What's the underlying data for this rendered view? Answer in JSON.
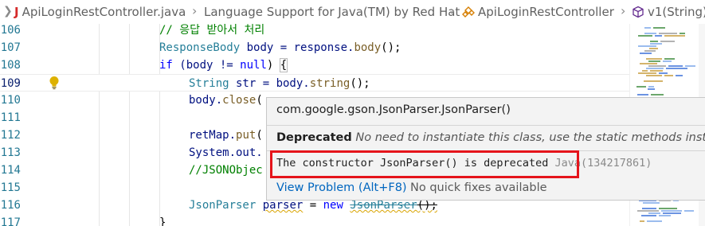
{
  "breadcrumb": {
    "chevron": "❯",
    "file_icon": "J",
    "file_name": "ApiLoginRestController.java",
    "extension": "Language Support for Java(TM) by Red Hat",
    "class_name": "ApiLoginRestController",
    "method_name": "v1(String)",
    "separator": "›"
  },
  "editor": {
    "lines": [
      {
        "number": "106",
        "comment": "// 응답 받아서 처리"
      },
      {
        "number": "107",
        "type": "ResponseBody",
        "rest": " body = response.",
        "fn": "body",
        "tail": "();"
      },
      {
        "number": "108",
        "kw": "if",
        "mid": " (body != ",
        "kw2": "null",
        "tail": ") ",
        "brace": "{"
      },
      {
        "number": "109",
        "type": "String",
        "rest": " str = body.",
        "fn": "string",
        "tail": "();"
      },
      {
        "number": "110",
        "rest": "body.",
        "fn": "close",
        "tail": "("
      },
      {
        "number": "111"
      },
      {
        "number": "112",
        "rest": "retMap.",
        "fn": "put",
        "tail": "("
      },
      {
        "number": "113",
        "rest": "System.out."
      },
      {
        "number": "114",
        "comment": "//JSONObjec"
      },
      {
        "number": "115"
      },
      {
        "number": "116",
        "type": "JsonParser",
        "var": "parser",
        "eq": " = ",
        "kw": "new",
        "ctor": "JsonParser",
        "tail": "();"
      },
      {
        "number": "117",
        "rest": "}"
      }
    ],
    "lightbulb_icon": "lightbulb-icon"
  },
  "hover": {
    "signature": "com.google.gson.JsonParser.JsonParser()",
    "deprecated_label": "Deprecated",
    "deprecated_text": "No need to instantiate this class, use the static methods instead.",
    "problem_message": "The constructor JsonParser() is deprecated",
    "problem_source": "Java(134217861)",
    "view_problem_label": "View Problem (Alt+F8)",
    "no_fixes_label": "No quick fixes available"
  },
  "colors": {
    "keyword": "#0000ff",
    "type": "#267f99",
    "comment": "#008000",
    "line_number": "#237893",
    "link": "#0066bf",
    "highlight_border": "#e5141b",
    "warning": "#d9a400"
  }
}
